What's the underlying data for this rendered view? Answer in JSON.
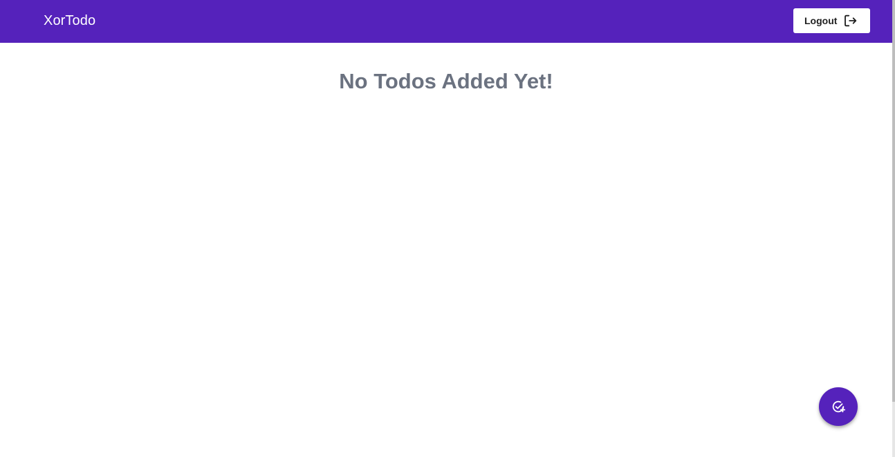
{
  "app": {
    "title": "XorTodo",
    "accent_color": "#5522bb"
  },
  "header": {
    "logout": {
      "label": "Logout",
      "icon": "logout-icon"
    }
  },
  "main": {
    "empty_message": "No Todos Added Yet!"
  },
  "fab": {
    "icon": "add-task-icon"
  }
}
